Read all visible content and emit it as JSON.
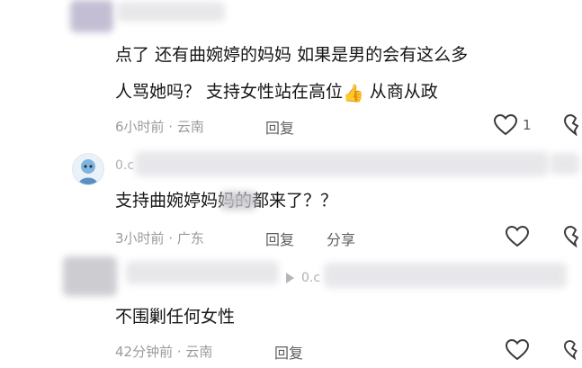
{
  "comments": [
    {
      "text_line1": "点了 还有曲婉婷的妈妈 如果是男的会有这么多",
      "text_line2_a": "人骂她吗？ 支持女性站在高位",
      "emoji": "👍",
      "text_line2_b": " 从商从政",
      "meta": "6小时前 · 云南",
      "reply_label": "回复",
      "like_count": "1"
    },
    {
      "username": "0.c",
      "text": "支持曲婉婷妈妈的都来了？？",
      "meta": "3小时前 · 广东",
      "reply_label": "回复",
      "share_label": "分享"
    },
    {
      "username": "0.c",
      "text": "不围剿任何女性",
      "meta": "42分钟前 · 云南",
      "reply_label": "回复"
    }
  ],
  "colors": {
    "text": "#161616",
    "meta": "#9b9b9b",
    "icon": "#3a3a3a"
  }
}
